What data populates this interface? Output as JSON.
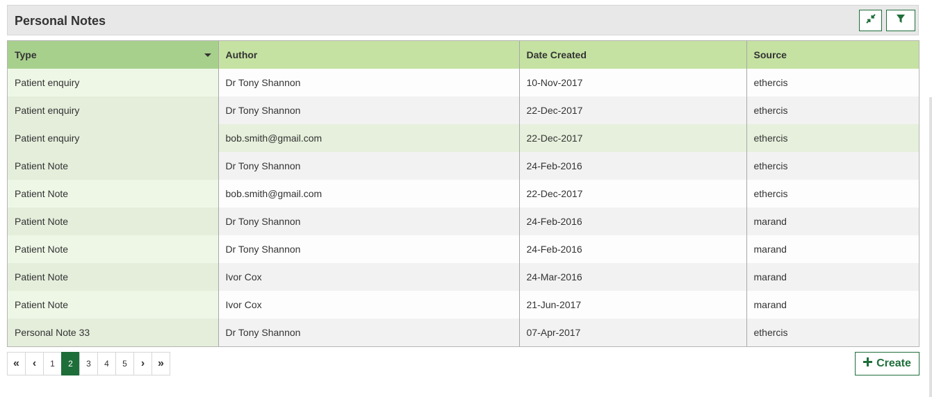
{
  "panel": {
    "title": "Personal Notes"
  },
  "table": {
    "columns": [
      "Type",
      "Author",
      "Date Created",
      "Source"
    ],
    "rows": [
      [
        "Patient enquiry",
        "Dr Tony Shannon",
        "10-Nov-2017",
        "ethercis"
      ],
      [
        "Patient enquiry",
        "Dr Tony Shannon",
        "22-Dec-2017",
        "ethercis"
      ],
      [
        "Patient enquiry",
        "bob.smith@gmail.com",
        "22-Dec-2017",
        "ethercis"
      ],
      [
        "Patient Note",
        "Dr Tony Shannon",
        "24-Feb-2016",
        "ethercis"
      ],
      [
        "Patient Note",
        "bob.smith@gmail.com",
        "22-Dec-2017",
        "ethercis"
      ],
      [
        "Patient Note",
        "Dr Tony Shannon",
        "24-Feb-2016",
        "marand"
      ],
      [
        "Patient Note",
        "Dr Tony Shannon",
        "24-Feb-2016",
        "marand"
      ],
      [
        "Patient Note",
        "Ivor Cox",
        "24-Mar-2016",
        "marand"
      ],
      [
        "Patient Note",
        "Ivor Cox",
        "21-Jun-2017",
        "marand"
      ],
      [
        "Personal Note 33",
        "Dr Tony Shannon",
        "07-Apr-2017",
        "ethercis"
      ]
    ]
  },
  "pagination": {
    "first": "«",
    "prev": "‹",
    "next": "›",
    "last": "»",
    "pages": [
      "1",
      "2",
      "3",
      "4",
      "5"
    ],
    "current": "2"
  },
  "create_button": {
    "label": "Create"
  },
  "colors": {
    "accent": "#1e6e3a",
    "header_bg": "#c5e2a2",
    "sorted_header_bg": "#a8d08d"
  }
}
